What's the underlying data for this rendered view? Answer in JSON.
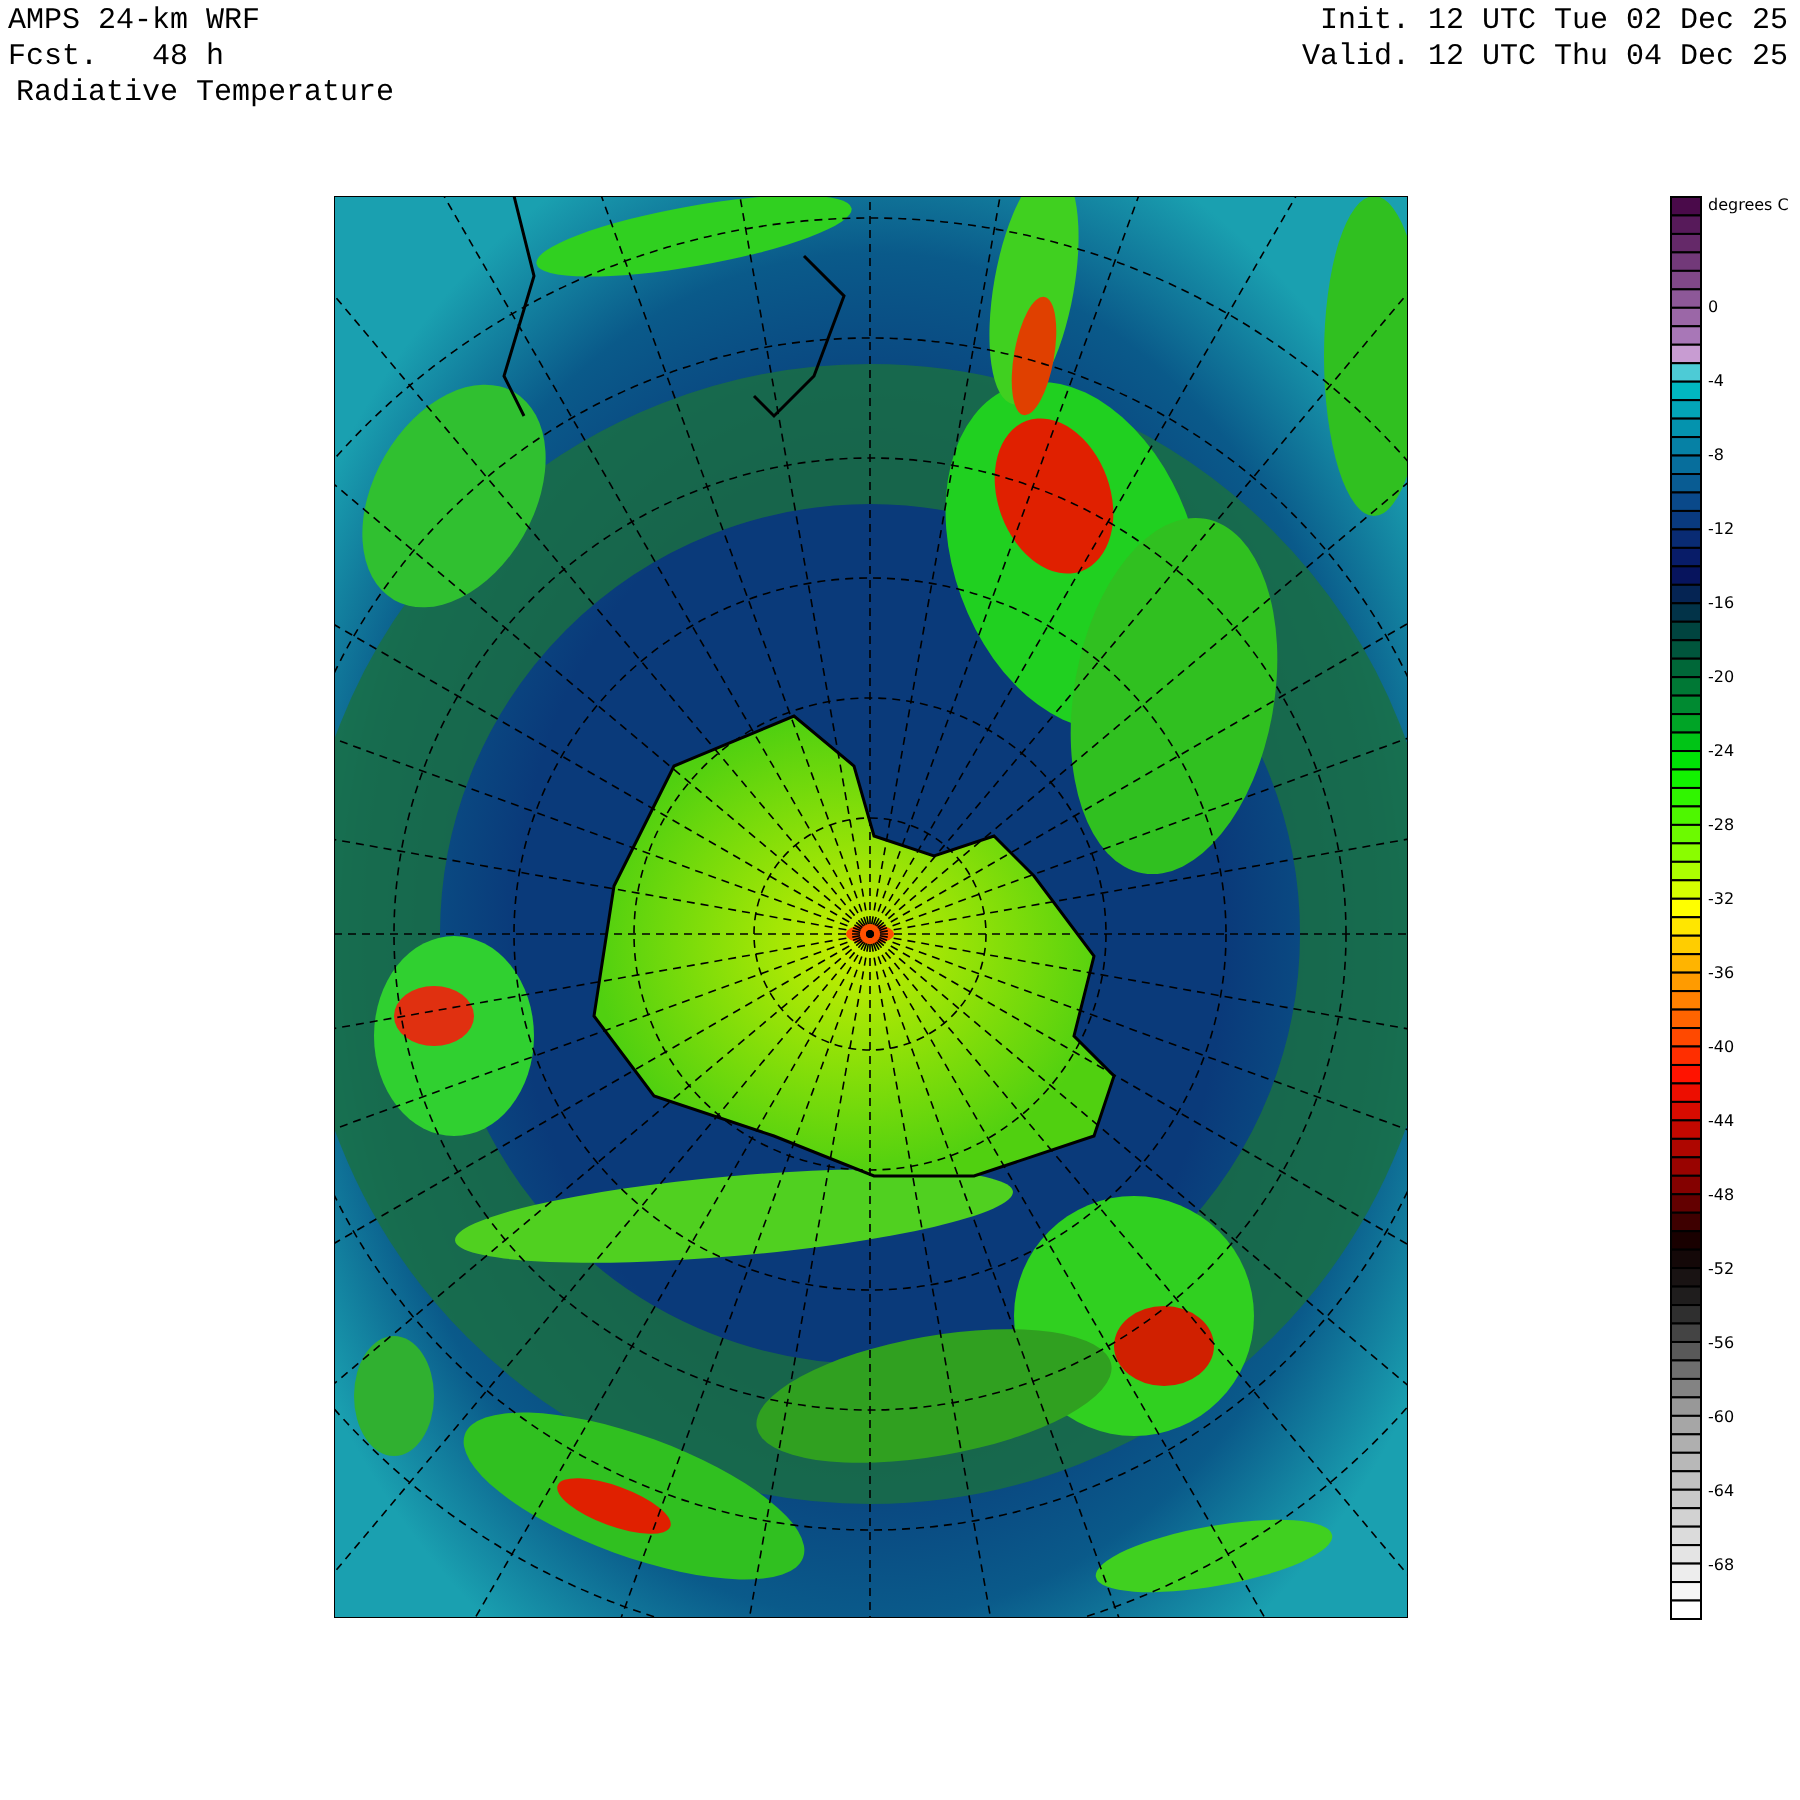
{
  "header": {
    "left": [
      "AMPS 24-km WRF",
      "Fcst.   48 h"
    ],
    "field": "Radiative Temperature",
    "right": [
      "Init. 12 UTC Tue 02 Dec 25",
      "Valid. 12 UTC Thu 04 Dec 25"
    ]
  },
  "colorbar": {
    "unit": "degrees C",
    "ticks": [
      "0",
      "-4",
      "-8",
      "-12",
      "-16",
      "-20",
      "-24",
      "-28",
      "-32",
      "-36",
      "-40",
      "-44",
      "-48",
      "-52",
      "-56",
      "-60",
      "-64",
      "-68"
    ]
  }
}
